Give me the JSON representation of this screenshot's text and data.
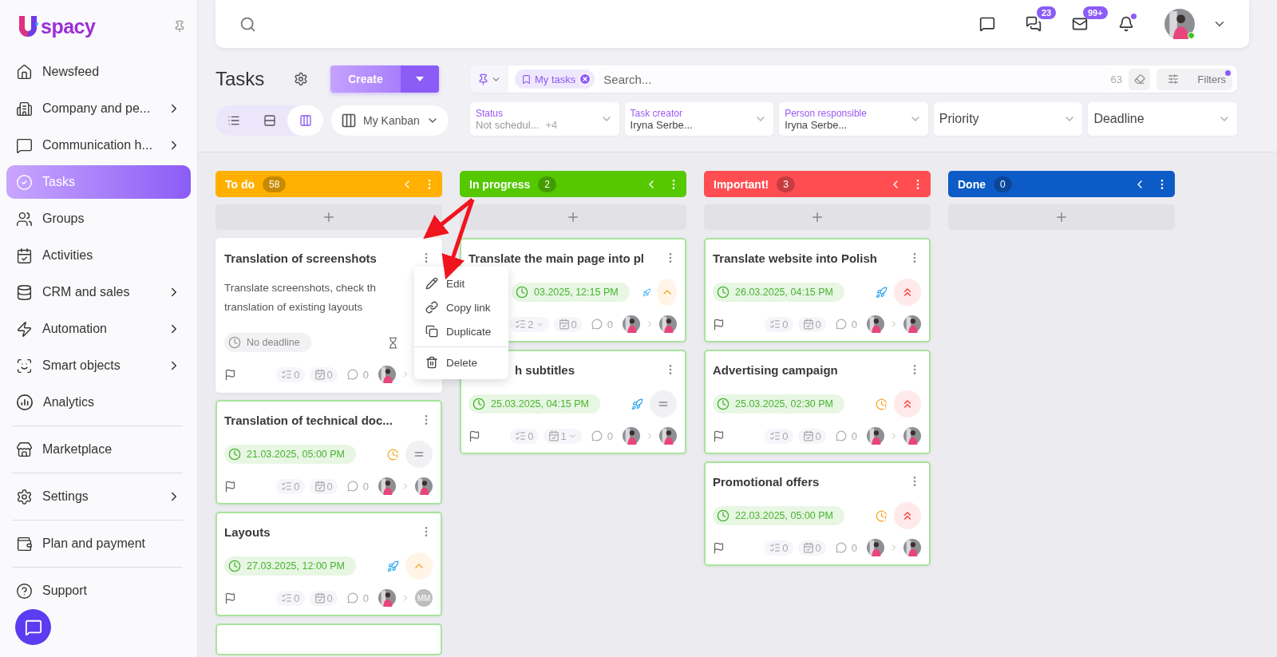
{
  "sidebar": {
    "logo_text": "spacy",
    "sections": [
      [
        {
          "label": "Newsfeed",
          "kind": "home",
          "has_submenu": false,
          "selected": false
        },
        {
          "label": "Company and pe...",
          "kind": "building",
          "has_submenu": true,
          "selected": false
        },
        {
          "label": "Communication h...",
          "kind": "phone-chat",
          "has_submenu": true,
          "selected": false
        },
        {
          "label": "Tasks",
          "kind": "check",
          "has_submenu": false,
          "selected": true
        },
        {
          "label": "Groups",
          "kind": "users",
          "has_submenu": false,
          "selected": false
        },
        {
          "label": "Activities",
          "kind": "calendar",
          "has_submenu": false,
          "selected": false
        },
        {
          "label": "CRM and sales",
          "kind": "coins",
          "has_submenu": true,
          "selected": false
        },
        {
          "label": "Automation",
          "kind": "zap",
          "has_submenu": true,
          "selected": false
        },
        {
          "label": "Smart objects",
          "kind": "scan",
          "has_submenu": true,
          "selected": false
        },
        {
          "label": "Analytics",
          "kind": "chart",
          "has_submenu": false,
          "selected": false
        }
      ],
      [
        {
          "label": "Marketplace",
          "kind": "store",
          "has_submenu": false,
          "selected": false
        }
      ],
      [
        {
          "label": "Settings",
          "kind": "gear",
          "has_submenu": true,
          "selected": false
        }
      ],
      [
        {
          "label": "Plan and payment",
          "kind": "wallet",
          "has_submenu": false,
          "selected": false
        }
      ],
      [
        {
          "label": "Support",
          "kind": "help",
          "has_submenu": false,
          "selected": false
        }
      ]
    ]
  },
  "topbar": {
    "chats_badge": "23",
    "mail_badge": "99+",
    "notifications_dot": true,
    "user_online": true
  },
  "header": {
    "title": "Tasks",
    "create_label": "Create",
    "views": [
      {
        "kind": "list",
        "selected": false
      },
      {
        "kind": "rows",
        "selected": false
      },
      {
        "kind": "columns",
        "selected": true
      }
    ],
    "kanban_label": "My Kanban",
    "search": {
      "tag": "My tasks",
      "placeholder": "Search...",
      "count": "63",
      "filters_label": "Filters",
      "filters_active": true
    },
    "filters": [
      {
        "label": "Status",
        "value": "Not schedul...",
        "extra": "+4"
      },
      {
        "label": "Task creator",
        "value": "Iryna Serbe..."
      },
      {
        "label": "Person responsible",
        "value": "Iryna Serbe..."
      },
      {
        "label": "Priority"
      },
      {
        "label": "Deadline"
      }
    ]
  },
  "columns": [
    {
      "title": "To do",
      "count": "58",
      "color": "#ffb000",
      "cards": [
        {
          "kind": "task",
          "title": "Translation of screenshots",
          "highlighted": false,
          "description": [
            "Translate screenshots, check th",
            "translation of existing layouts"
          ],
          "date": {
            "kind": "none",
            "text": "No deadline"
          },
          "indicator": {
            "kind": "hourglass"
          },
          "subtasks": {
            "count": "0",
            "expandable": false
          },
          "checklist": {
            "count": "0",
            "expandable": false
          },
          "comments": "0",
          "creator": {
            "kind": "photo"
          }
        },
        {
          "kind": "task",
          "title": "Translation of technical doc...",
          "highlighted": true,
          "date": {
            "kind": "set",
            "text": "21.03.2025, 05:00 PM"
          },
          "indicator": {
            "kind": "clock"
          },
          "priority": {
            "kind": "medium"
          },
          "subtasks": {
            "count": "0",
            "expandable": false
          },
          "checklist": {
            "count": "0",
            "expandable": false
          },
          "comments": "0",
          "creator": {
            "kind": "photo"
          },
          "responsible": {
            "kind": "photo"
          }
        },
        {
          "kind": "task",
          "title": "Layouts",
          "highlighted": true,
          "date": {
            "kind": "set",
            "text": "27.03.2025, 12:00 PM"
          },
          "indicator": {
            "kind": "rocket"
          },
          "priority": {
            "kind": "high"
          },
          "subtasks": {
            "count": "0",
            "expandable": false
          },
          "checklist": {
            "count": "0",
            "expandable": false
          },
          "comments": "0",
          "creator": {
            "kind": "photo"
          },
          "responsible": {
            "kind": "initials",
            "text": "MM"
          }
        },
        {
          "kind": "stub",
          "highlighted": true
        }
      ]
    },
    {
      "title": "In progress",
      "count": "2",
      "color": "#55c800",
      "cards": [
        {
          "kind": "task",
          "title": "Translate the main page into pl",
          "highlighted": true,
          "date": {
            "kind": "set",
            "text": "03.2025, 12:15 PM",
            "covered": true
          },
          "flag_hidden": true,
          "indicator": {
            "kind": "rocket"
          },
          "priority": {
            "kind": "high"
          },
          "subtasks": {
            "count": "2",
            "expandable": true
          },
          "checklist": {
            "count": "0",
            "expandable": false
          },
          "comments": "0",
          "creator": {
            "kind": "photo"
          },
          "responsible": {
            "kind": "photo"
          }
        },
        {
          "kind": "task",
          "title": "h subtitles",
          "title_covered": true,
          "highlighted": true,
          "date": {
            "kind": "set",
            "text": "25.03.2025, 04:15 PM"
          },
          "indicator": {
            "kind": "rocket"
          },
          "priority": {
            "kind": "medium"
          },
          "subtasks": {
            "count": "0",
            "expandable": false
          },
          "checklist": {
            "count": "1",
            "expandable": true
          },
          "comments": "0",
          "creator": {
            "kind": "photo"
          },
          "responsible": {
            "kind": "photo"
          }
        }
      ]
    },
    {
      "title": "Important!",
      "count": "3",
      "color": "#ff4d52",
      "cards": [
        {
          "kind": "task",
          "title": "Translate website into Polish",
          "highlighted": true,
          "date": {
            "kind": "set",
            "text": "26.03.2025, 04:15 PM"
          },
          "indicator": {
            "kind": "rocket"
          },
          "priority": {
            "kind": "urgent"
          },
          "subtasks": {
            "count": "0",
            "expandable": false
          },
          "checklist": {
            "count": "0",
            "expandable": false
          },
          "comments": "0",
          "creator": {
            "kind": "photo"
          },
          "responsible": {
            "kind": "photo"
          }
        },
        {
          "kind": "task",
          "title": "Advertising campaign",
          "highlighted": true,
          "date": {
            "kind": "set",
            "text": "25.03.2025, 02:30 PM"
          },
          "indicator": {
            "kind": "clock"
          },
          "priority": {
            "kind": "urgent"
          },
          "subtasks": {
            "count": "0",
            "expandable": false
          },
          "checklist": {
            "count": "0",
            "expandable": false
          },
          "comments": "0",
          "creator": {
            "kind": "photo"
          },
          "responsible": {
            "kind": "photo"
          }
        },
        {
          "kind": "task",
          "title": "Promotional offers",
          "highlighted": true,
          "date": {
            "kind": "set",
            "text": "22.03.2025, 05:00 PM"
          },
          "indicator": {
            "kind": "clock"
          },
          "priority": {
            "kind": "urgent"
          },
          "subtasks": {
            "count": "0",
            "expandable": false
          },
          "checklist": {
            "count": "0",
            "expandable": false
          },
          "comments": "0",
          "creator": {
            "kind": "photo"
          },
          "responsible": {
            "kind": "photo"
          }
        }
      ]
    },
    {
      "title": "Done",
      "count": "0",
      "color": "#0d5bc6"
    }
  ],
  "context_menu": {
    "items": [
      {
        "label": "Edit",
        "kind": "pencil"
      },
      {
        "label": "Copy link",
        "kind": "link"
      },
      {
        "label": "Duplicate",
        "kind": "copy"
      },
      {
        "label": "Delete",
        "kind": "trash",
        "divider_before": true
      }
    ]
  }
}
